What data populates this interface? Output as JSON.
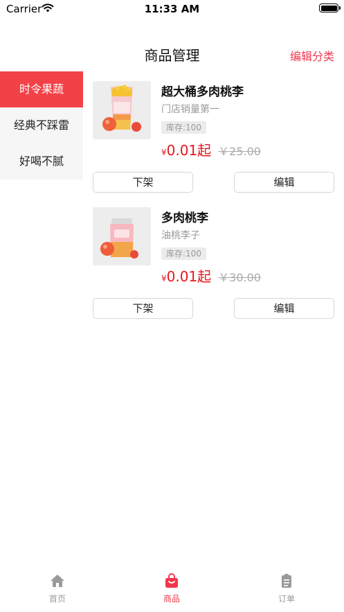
{
  "status_bar": {
    "carrier": "Carrier",
    "time": "11:33 AM"
  },
  "nav": {
    "title": "商品管理",
    "action": "编辑分类"
  },
  "sidebar": {
    "items": [
      {
        "label": "时令果蔬",
        "active": true
      },
      {
        "label": "经典不踩雷",
        "active": false
      },
      {
        "label": "好喝不腻",
        "active": false
      }
    ]
  },
  "products": [
    {
      "name": "超大桶多肉桃李",
      "desc": "门店销量第一",
      "stock": "库存:100",
      "currency": "¥",
      "price": "0.01起",
      "original_price": "￥25.00",
      "btn_off": "下架",
      "btn_edit": "编辑"
    },
    {
      "name": "多肉桃李",
      "desc": "油桃李子",
      "stock": "库存:100",
      "currency": "¥",
      "price": "0.01起",
      "original_price": "￥30.00",
      "btn_off": "下架",
      "btn_edit": "编辑"
    }
  ],
  "tab_bar": {
    "items": [
      {
        "label": "首页",
        "icon": "home-icon",
        "active": false
      },
      {
        "label": "商品",
        "icon": "bag-icon",
        "active": true
      },
      {
        "label": "订单",
        "icon": "clipboard-icon",
        "active": false
      }
    ]
  },
  "colors": {
    "accent": "#f1374d",
    "price": "#e8141c",
    "sidebar_active": "#f24248"
  }
}
